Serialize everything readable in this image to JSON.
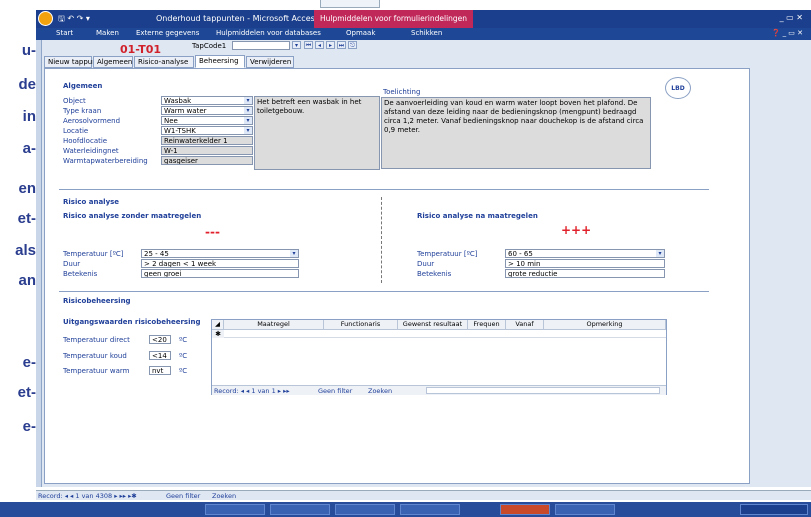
{
  "slide_text": {
    "l1": "u-",
    "l2": "de",
    "l3": "in",
    "l4": "a-",
    "l5": "en",
    "l6": "et-",
    "l7": "als",
    "l8": "an",
    "l9": "e-",
    "l10": "et-",
    "l11": "e-"
  },
  "window": {
    "title": "Onderhoud tappunten - Microsoft Access",
    "context_tab": "Hulpmiddelen voor formulierindelingen",
    "controls": "_ ▭ ✕"
  },
  "ribbon": {
    "tabs": [
      "Start",
      "Maken",
      "Externe gegevens",
      "Hulpmiddelen voor databases",
      "Opmaak",
      "Schikken"
    ]
  },
  "form": {
    "code": "01-T01",
    "tapcode_label": "TapCode1",
    "tabs": [
      "Nieuw tappunt",
      "Algemeen",
      "Risico-analyse",
      "Beheersing",
      "Verwijderen"
    ],
    "logo": "LBD",
    "algemeen": {
      "header": "Algemeen",
      "object_label": "Object",
      "object": "Wasbak",
      "type_label": "Type kraan",
      "type": "Warm water",
      "aerosol_label": "Aerosolvormend",
      "aerosol": "Nee",
      "locatie_label": "Locatie",
      "locatie": "W1-TSHK",
      "hoofd_label": "Hoofdlocatie",
      "hoofd": "Reinwaterkelder 1",
      "net_label": "Waterleidingnet",
      "net": "W-1",
      "wwb_label": "Warmtapwaterbereiding",
      "wwb": "gasgeiser",
      "desc": "Het betreft een wasbak in het toiletgebouw."
    },
    "toelichting": {
      "header": "Toelichting",
      "text": "De aanvoerleiding van koud en warm water loopt boven het plafond. De afstand van deze leiding naar de bedieningsknop (mengpunt) bedraagd circa 1,2 meter. Vanaf bedieningsknop naar douchekop is de afstand circa 0,9 meter."
    },
    "risico": {
      "header": "Risico analyse",
      "zonder_header": "Risico analyse zonder maatregelen",
      "zonder_score": "---",
      "na_header": "Risico analyse na maatregelen",
      "na_score": "+++",
      "temp_label": "Temperatuur [ºC]",
      "duur_label": "Duur",
      "bet_label": "Betekenis",
      "temp_zonder": "25 - 45",
      "duur_zonder": "> 2 dagen < 1 week",
      "bet_zonder": "geen groei",
      "temp_na": "60 - 65",
      "duur_na": "> 10 min",
      "bet_na": "grote reductie"
    },
    "beheersing": {
      "header": "Risicobeheersing",
      "sub": "Uitgangswaarden risicobeheersing",
      "td_label": "Temperatuur direct",
      "td": "<20",
      "tk_label": "Temperatuur koud",
      "tk": "<14",
      "tw_label": "Temperatuur warm",
      "tw": "nvt",
      "unit": "ºC",
      "columns": [
        "Maatregel",
        "Functionaris",
        "Gewenst resultaat",
        "Frequen",
        "Vanaf",
        "Opmerking"
      ],
      "record": "Record: ◂ ◂ 1 van 1 ▸ ▸▸",
      "filter": "Geen filter",
      "zoeken": "Zoeken"
    }
  },
  "status": {
    "record": "Record: ◂ ◂ 1 van 4308 ▸ ▸▸ ▸✱",
    "filter": "Geen filter",
    "zoeken": "Zoeken"
  }
}
